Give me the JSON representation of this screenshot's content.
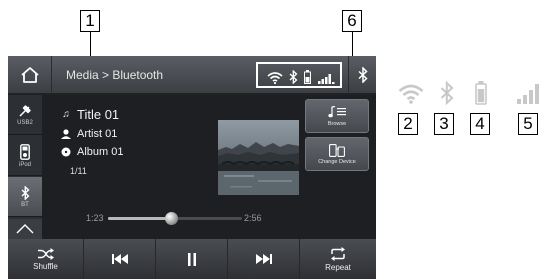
{
  "callouts": [
    "1",
    "2",
    "3",
    "4",
    "5",
    "6"
  ],
  "header": {
    "breadcrumb": "Media > Bluetooth"
  },
  "status_icons": [
    "wifi-icon",
    "bluetooth-icon",
    "battery-icon",
    "signal-icon"
  ],
  "sidebar": {
    "sources": [
      {
        "label": "USB2",
        "icon": "usb-icon"
      },
      {
        "label": "iPod",
        "icon": "ipod-icon"
      },
      {
        "label": "BT",
        "icon": "bluetooth-icon"
      }
    ]
  },
  "track": {
    "title": "Title 01",
    "artist": "Artist 01",
    "album": "Album 01",
    "count": "1/11",
    "elapsed": "1:23",
    "total": "2:56",
    "progress": 0.47
  },
  "buttons": {
    "browse": "Browse",
    "change_device": "Change Device",
    "shuffle": "Shuffle",
    "repeat": "Repeat"
  },
  "colors": {
    "screen": "#202226",
    "topbar": "#4a4d52",
    "text": "#f2f2f2"
  }
}
